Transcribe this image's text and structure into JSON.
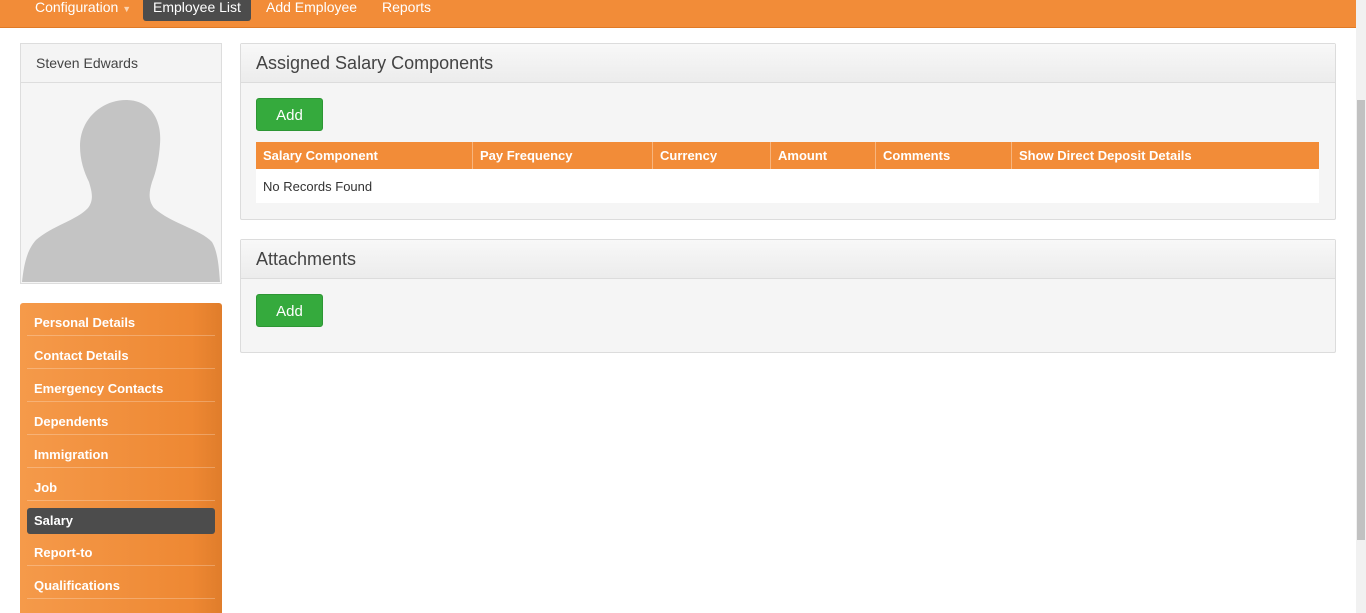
{
  "topnav": {
    "items": [
      {
        "label": "Configuration",
        "has_dropdown": true
      },
      {
        "label": "Employee List",
        "active": true
      },
      {
        "label": "Add Employee"
      },
      {
        "label": "Reports"
      }
    ]
  },
  "profile": {
    "name": "Steven Edwards"
  },
  "sidemenu": {
    "items": [
      {
        "label": "Personal Details"
      },
      {
        "label": "Contact Details"
      },
      {
        "label": "Emergency Contacts"
      },
      {
        "label": "Dependents"
      },
      {
        "label": "Immigration"
      },
      {
        "label": "Job"
      },
      {
        "label": "Salary",
        "active": true
      },
      {
        "label": "Report-to"
      },
      {
        "label": "Qualifications"
      }
    ]
  },
  "salary_panel": {
    "title": "Assigned Salary Components",
    "add_label": "Add",
    "columns": [
      "Salary Component",
      "Pay Frequency",
      "Currency",
      "Amount",
      "Comments",
      "Show Direct Deposit Details"
    ],
    "empty_text": "No Records Found"
  },
  "attachments_panel": {
    "title": "Attachments",
    "add_label": "Add"
  },
  "colors": {
    "accent": "#f28c38",
    "active_item": "#4c4c4c",
    "add_button": "#35aa3d"
  }
}
